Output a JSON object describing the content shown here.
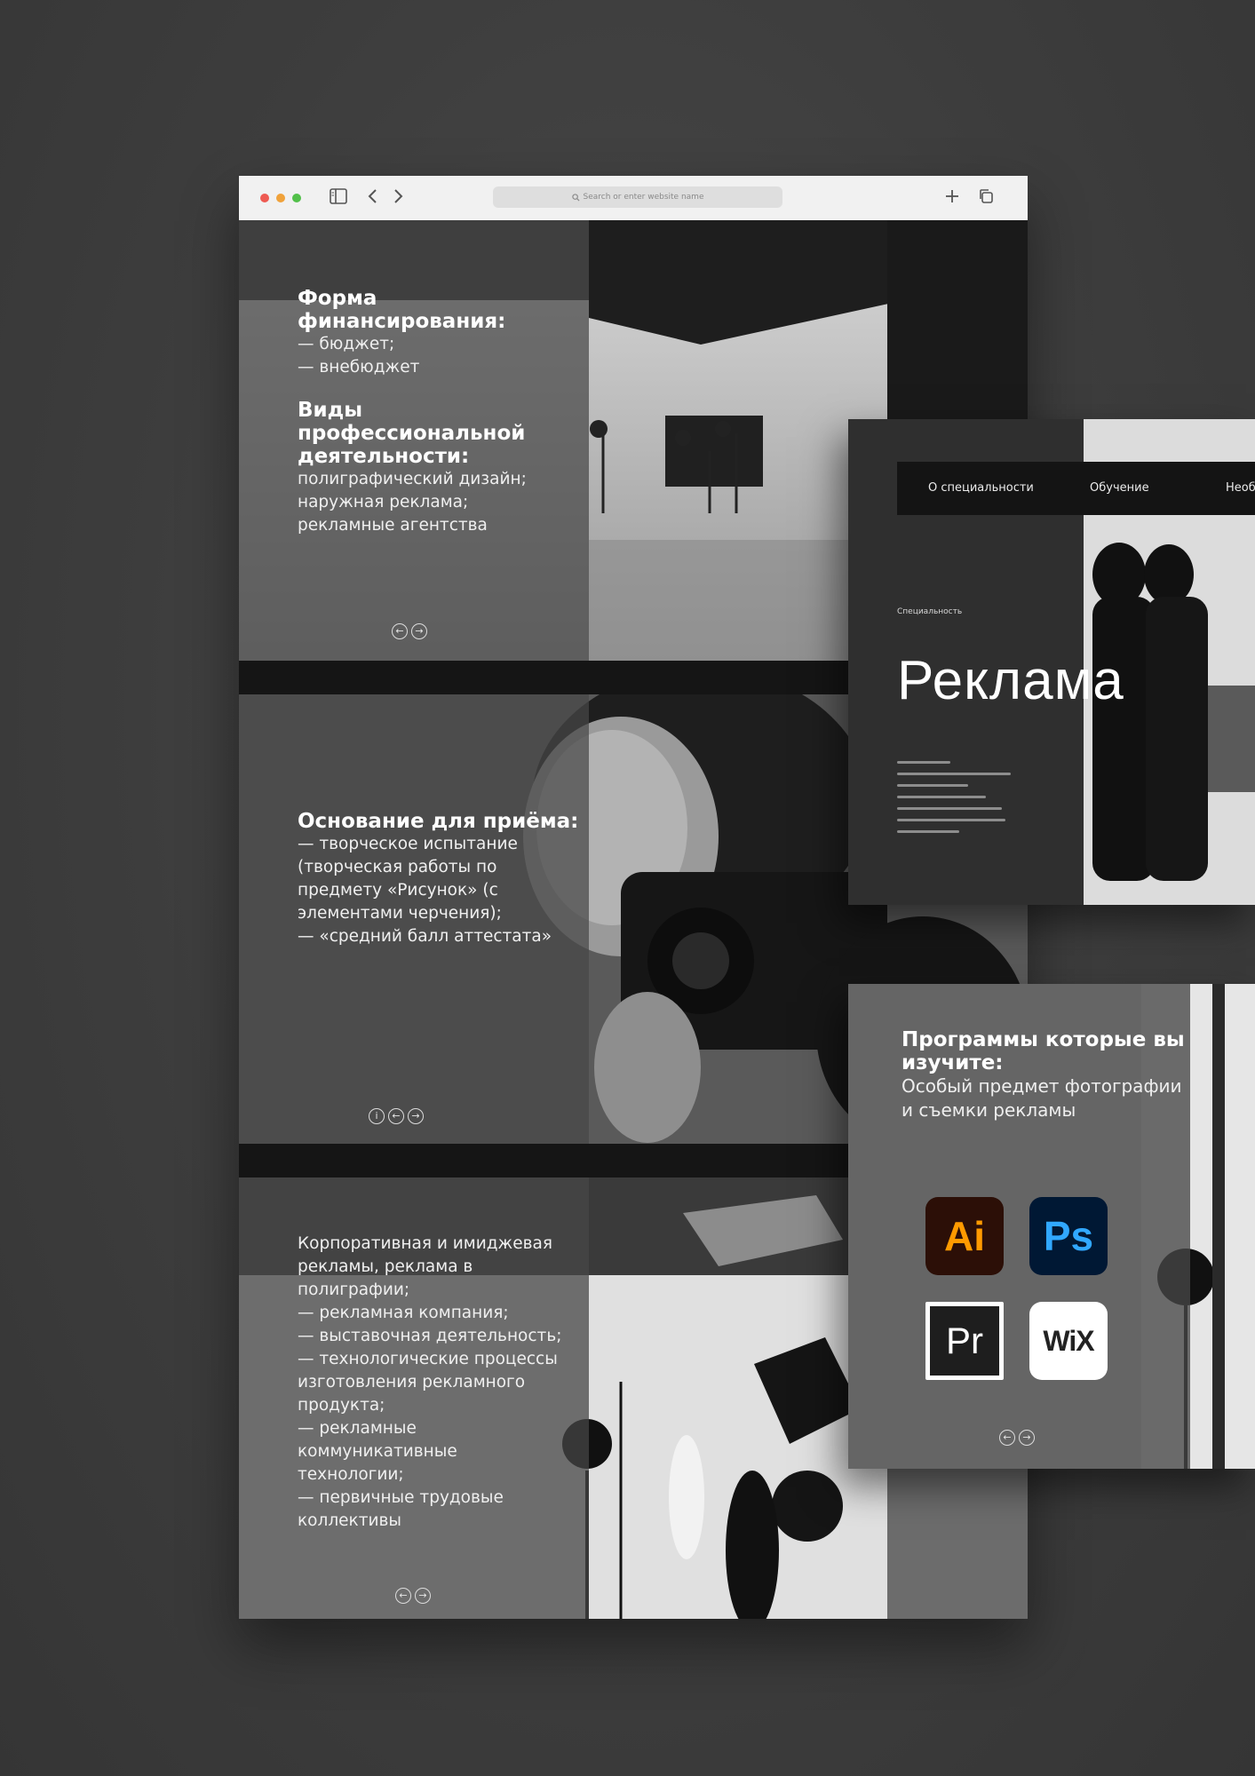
{
  "browser": {
    "url_placeholder": "Search or enter website name"
  },
  "sections": [
    {
      "blocks": [
        {
          "heading": "Форма финансирования:",
          "body": "— бюджет;\n— внебюджет"
        },
        {
          "heading": "Виды профессиональной деятельности:",
          "body": "полиграфический дизайн;\nнаружная реклама;\nрекламные агентства"
        }
      ]
    },
    {
      "blocks": [
        {
          "heading": "Основание для приёма:",
          "body": "— творческое испытание (творческая работы по предмету «Рисунок» (с элементами черчения);\n— «средний балл аттестата»"
        }
      ]
    },
    {
      "blocks": [
        {
          "heading": "",
          "body": "Корпоративная и имиджевая рекламы, реклама в полиграфии;\n— рекламная компания;\n— выставочная деятельность;\n— технологические процессы изготовления рекламного продукта;\n— рекламные коммуникативные технологии;\n— первичные трудовые коллективы"
        }
      ]
    }
  ],
  "card1": {
    "nav": [
      "О специальности",
      "Обучение",
      "Необ"
    ],
    "eyebrow": "Специальность",
    "title": "Реклама"
  },
  "card2": {
    "heading": "Программы которые вы изучите:",
    "body": "Особый предмет фотографии и съемки рекламы",
    "apps": [
      "Ai",
      "Ps",
      "Pr",
      "WiX"
    ]
  },
  "icons": {
    "prev": "arrow-left-icon",
    "next": "arrow-right-icon",
    "info": "info-icon",
    "sidebar": "sidebar-icon",
    "back": "chevron-left-icon",
    "forward": "chevron-right-icon",
    "search": "search-icon",
    "new_tab": "plus-icon",
    "tabs": "tabs-icon"
  },
  "colors": {
    "window_red": "#ee5a52",
    "window_yellow": "#f0a23b",
    "window_green": "#52c04a",
    "ai_brand": "#ff9a00",
    "ps_brand": "#31a8ff"
  }
}
